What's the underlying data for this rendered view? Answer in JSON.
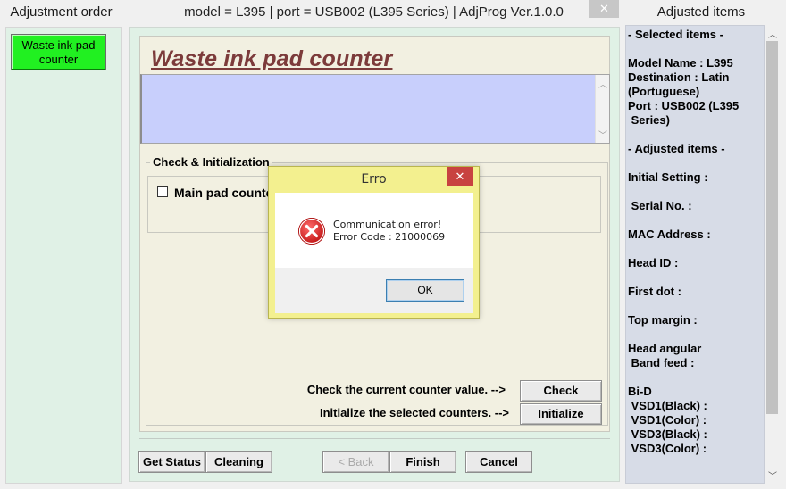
{
  "left_pane": {
    "title": "Adjustment order",
    "items": [
      {
        "label": "Waste ink pad counter",
        "color": "#21f021"
      }
    ]
  },
  "window": {
    "title": "model = L395 | port = USB002 (L395 Series) | AdjProg Ver.1.0.0",
    "close_glyph": "✕",
    "heading": "Waste ink pad counter",
    "group_label": "Check & Initialization",
    "main_pad_label": "Main pad counter",
    "check_hint": "Check the current counter value.  -->",
    "init_hint": "Initialize the selected counters.  -->",
    "buttons": {
      "check": "Check",
      "initialize": "Initialize",
      "get_status": "Get Status",
      "cleaning": "Cleaning",
      "back": "< Back",
      "finish": "Finish",
      "cancel": "Cancel"
    }
  },
  "right_pane": {
    "title": "Adjusted items",
    "content": "- Selected items -\n\nModel Name : L395\nDestination : Latin\n(Portuguese)\nPort : USB002 (L395\n Series)\n\n- Adjusted items -\n\nInitial Setting :\n\n Serial No. :\n\nMAC Address :\n\nHead ID :\n\nFirst dot :\n\nTop margin :\n\nHead angular\n Band feed :\n\nBi-D\n VSD1(Black) :\n VSD1(Color) :\n VSD3(Black) :\n VSD3(Color) :"
  },
  "dialog": {
    "title": "Erro",
    "close_glyph": "✕",
    "message_line1": "Communication error!",
    "message_line2": "Error Code : 21000069",
    "ok_label": "OK",
    "icon": "error-icon"
  },
  "colors": {
    "heading": "#7c3b3b",
    "info_box": "#c8cffc",
    "left_active": "#21f021",
    "dialog_frame": "#f3f08f",
    "dialog_close": "#c84340",
    "error_icon": "#d42020"
  }
}
